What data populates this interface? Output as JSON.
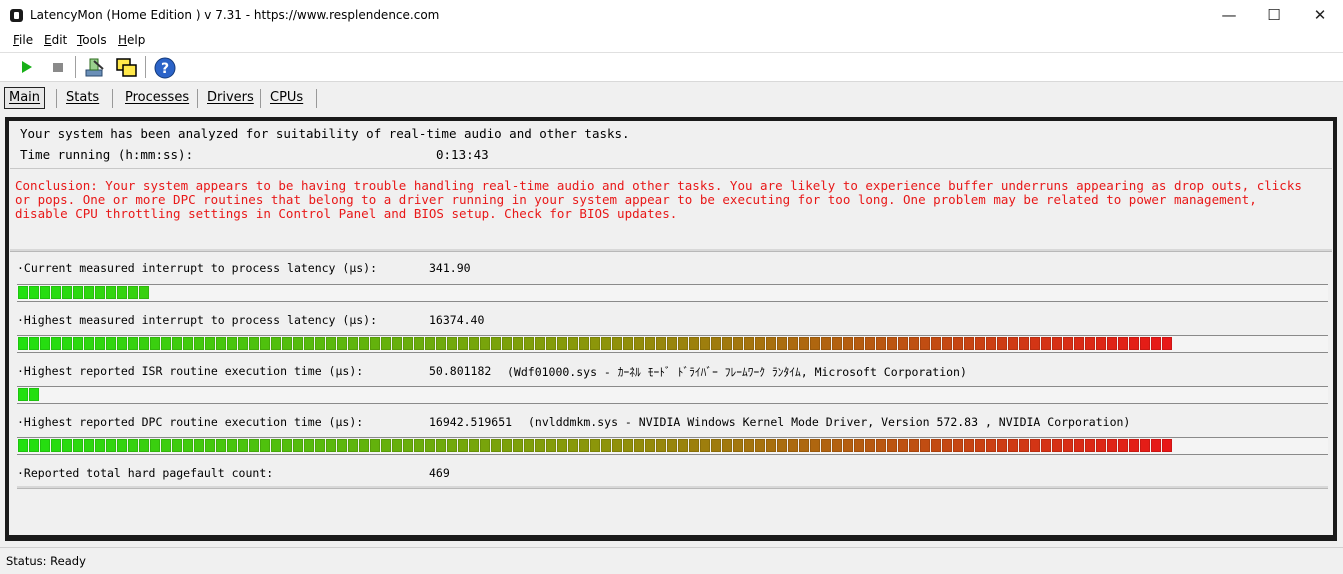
{
  "window": {
    "title": "LatencyMon  (Home Edition )  v 7.31 - https://www.resplendence.com",
    "minimize": "—",
    "maximize": "☐",
    "close": "✕"
  },
  "menu": [
    "File",
    "Edit",
    "Tools",
    "Help"
  ],
  "toolbar": {
    "buttons": [
      "play-icon",
      "stop-icon",
      "submit-icon",
      "windows-icon",
      "help-icon"
    ]
  },
  "tabs": [
    "Main",
    "Stats",
    "Processes",
    "Drivers",
    "CPUs"
  ],
  "summary": {
    "analyzed_text": "Your system has been analyzed for suitability of real-time audio and other tasks.",
    "time_label": "Time running (h:mm:ss):",
    "time_value": "0:13:43",
    "conclusion": "Conclusion: Your system appears to be having trouble handling real-time audio and other tasks. You are likely to experience buffer underruns appearing as drop outs, clicks or pops. One or more DPC routines that belong to a driver running in your system appear to be executing for too long. One problem may be related to power management, disable CPU throttling settings in Control Panel and BIOS setup. Check for BIOS updates."
  },
  "metrics": [
    {
      "label": "·Current measured interrupt to process latency (µs):",
      "value": "341.90",
      "detail": "",
      "segments": 12
    },
    {
      "label": "·Highest measured interrupt to process latency (µs):",
      "value": "16374.40",
      "detail": "",
      "segments": 105
    },
    {
      "label": "·Highest reported ISR routine execution time (µs):",
      "value": "50.801182",
      "detail": "(Wdf01000.sys - ｶｰﾈﾙ ﾓｰﾄﾞ ﾄﾞﾗｲﾊﾞｰ ﾌﾚｰﾑﾜｰｸ ﾗﾝﾀｲﾑ, Microsoft Corporation)",
      "segments": 2
    },
    {
      "label": "·Highest reported DPC routine execution time (µs):",
      "value": "16942.519651",
      "detail": "(nvlddmkm.sys - NVIDIA Windows Kernel Mode Driver, Version 572.83 , NVIDIA Corporation)",
      "segments": 105
    },
    {
      "label": "·Reported total hard pagefault count:",
      "value": "469",
      "detail": "",
      "segments": 0
    }
  ],
  "colors": {
    "conclusion": "#e81818",
    "bar_low": "#22e010",
    "bar_high": "#e81818"
  },
  "status": "Status: Ready"
}
